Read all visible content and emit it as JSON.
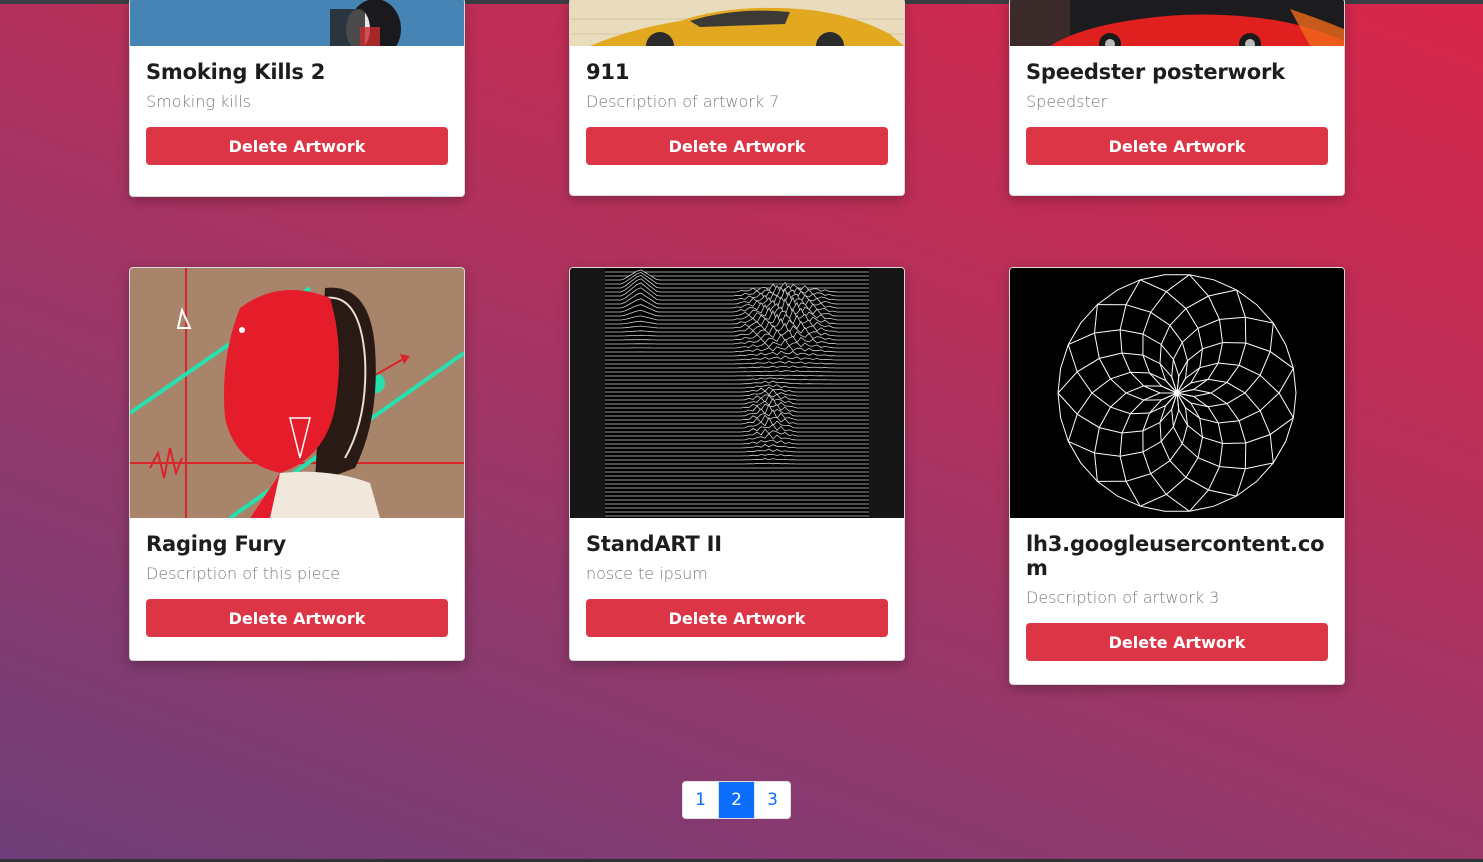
{
  "cards": [
    {
      "title": "Smoking Kills 2",
      "description": "Smoking kills",
      "button": "Delete Artwork"
    },
    {
      "title": "911",
      "description": "Description of artwork 7",
      "button": "Delete Artwork"
    },
    {
      "title": "Speedster posterwork",
      "description": "Speedster",
      "button": "Delete Artwork"
    },
    {
      "title": "Raging Fury",
      "description": "Description of this piece",
      "button": "Delete Artwork"
    },
    {
      "title": "StandART II",
      "description": "nosce te ipsum",
      "button": "Delete Artwork"
    },
    {
      "title": "lh3.googleusercontent.com",
      "description": "Description of artwork 3",
      "button": "Delete Artwork"
    }
  ],
  "pagination": {
    "pages": [
      "1",
      "2",
      "3"
    ],
    "current": "2"
  },
  "colors": {
    "delete_button": "#dc3545",
    "page_active": "#0d6efd"
  }
}
